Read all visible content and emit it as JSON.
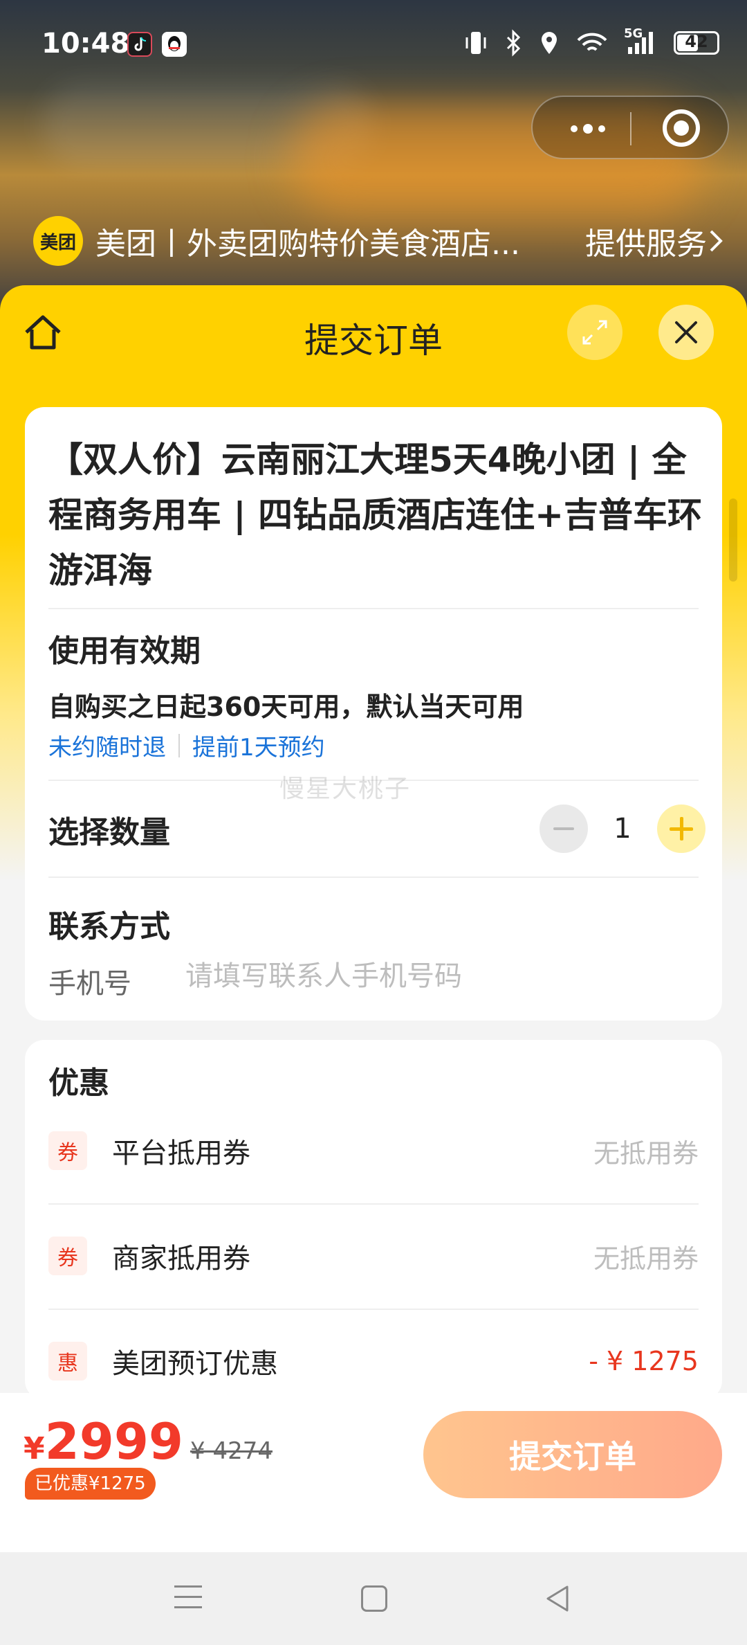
{
  "status_bar": {
    "time": "10:48",
    "network": "5G",
    "battery": "42"
  },
  "capsule": {
    "more_icon": "more-dots-icon",
    "close_icon": "target-icon"
  },
  "service_bar": {
    "logo_text": "美团",
    "title": "美团丨外卖团购特价美食酒店...",
    "link_label": "提供服务"
  },
  "sheet": {
    "title": "提交订单"
  },
  "product": {
    "title": "【双人价】云南丽江大理5天4晚小团 | 全程商务用车 |  四钻品质酒店连住+吉普车环游洱海"
  },
  "validity": {
    "label": "使用有效期",
    "text": "自购买之日起360天可用，默认当天可用",
    "tag1": "未约随时退",
    "tag2": "提前1天预约"
  },
  "watermark": "慢星大桃子",
  "quantity": {
    "label": "选择数量",
    "value": "1"
  },
  "contact": {
    "label": "联系方式",
    "phone_label": "手机号",
    "phone_placeholder": "请填写联系人手机号码",
    "phone_value": ""
  },
  "discounts": {
    "title": "优惠",
    "rows": [
      {
        "icon": "券",
        "name": "平台抵用券",
        "value": "无抵用券"
      },
      {
        "icon": "券",
        "name": "商家抵用券",
        "value": "无抵用券"
      },
      {
        "icon": "惠",
        "name": "美团预订优惠",
        "value": "- ¥ 1275"
      }
    ]
  },
  "footer": {
    "currency": "¥",
    "price": "2999",
    "original_price": "¥ 4274",
    "saved": "已优惠¥1275",
    "submit_label": "提交订单"
  },
  "colors": {
    "brand_yellow": "#ffd100",
    "price_red": "#f23a2a",
    "link_blue": "#1a73d9",
    "submit_gradient_start": "#ffc58e",
    "submit_gradient_end": "#ffa98a"
  }
}
